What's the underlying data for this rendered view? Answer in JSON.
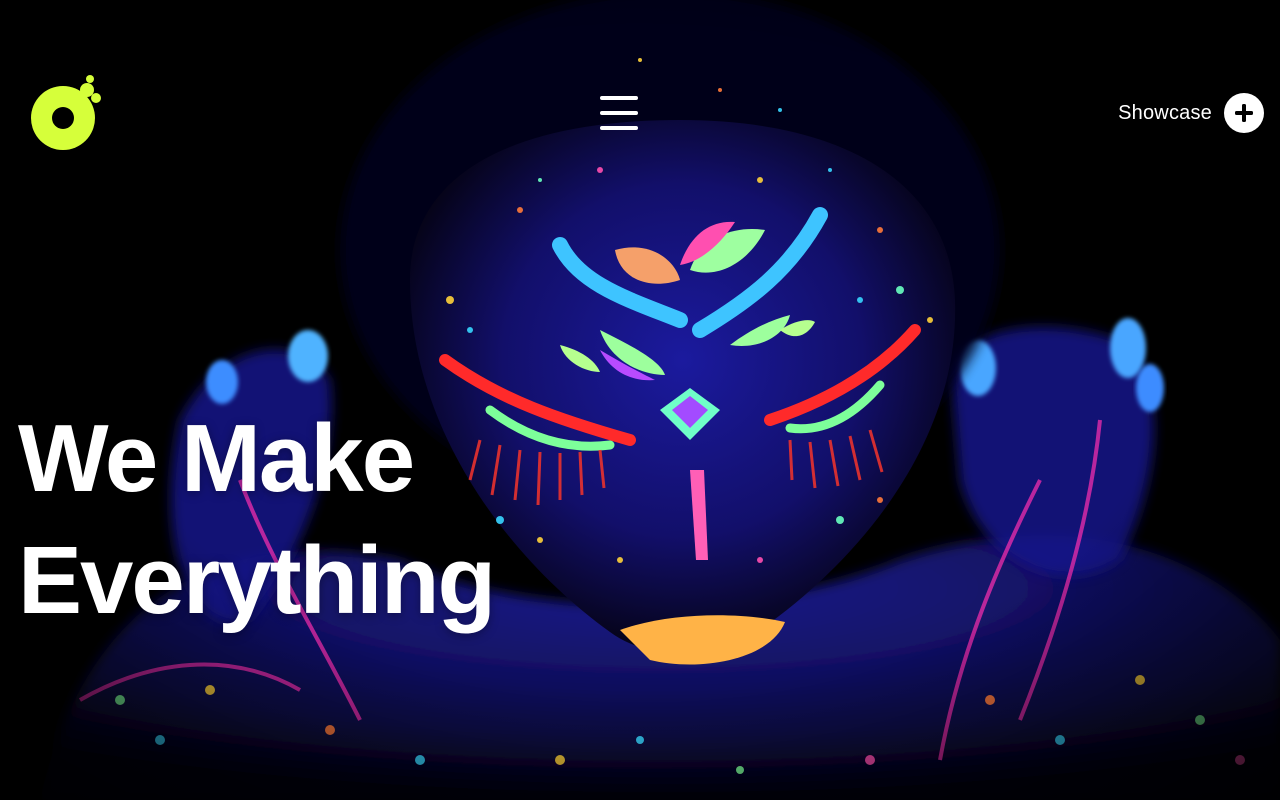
{
  "nav": {
    "logo_icon": "dot-bubbles-logo-icon",
    "menu_icon": "hamburger-menu-icon",
    "showcase_label": "Showcase",
    "showcase_icon": "plus-icon"
  },
  "hero": {
    "headline_line1": "We Make",
    "headline_line2": "Everything",
    "background": "neon-face-paint-portrait"
  },
  "colors": {
    "accent": "#d6ff3a",
    "background": "#000000",
    "text": "#ffffff"
  }
}
